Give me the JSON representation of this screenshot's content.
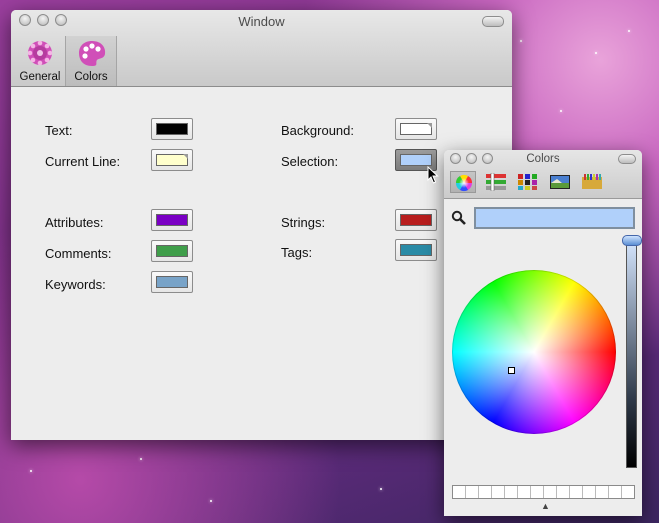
{
  "prefs_window": {
    "title": "Window",
    "toolbar": [
      {
        "label": "General",
        "icon": "gear-icon",
        "selected": false
      },
      {
        "label": "Colors",
        "icon": "palette-icon",
        "selected": true
      }
    ],
    "left_column": [
      {
        "label": "Text:",
        "color": "#000000"
      },
      {
        "label": "Current Line:",
        "color": "#ffffcc"
      },
      {
        "label": "Attributes:",
        "color": "#7a00c4"
      },
      {
        "label": "Comments:",
        "color": "#3f9e4a"
      },
      {
        "label": "Keywords:",
        "color": "#78a3c8"
      }
    ],
    "right_column": [
      {
        "label": "Background:",
        "color": "#ffffff"
      },
      {
        "label": "Selection:",
        "color": "#b0d0fa",
        "active": true
      },
      {
        "label": "Strings:",
        "color": "#b81e1e"
      },
      {
        "label": "Tags:",
        "color": "#2a8ba6"
      }
    ]
  },
  "colors_panel": {
    "title": "Colors",
    "modes": [
      "color-wheel-icon",
      "color-sliders-icon",
      "color-palettes-icon",
      "image-palettes-icon",
      "crayons-icon"
    ],
    "selected_mode": 0,
    "current_color": "#b0d0fa",
    "search_icon": "magnifier-icon"
  }
}
